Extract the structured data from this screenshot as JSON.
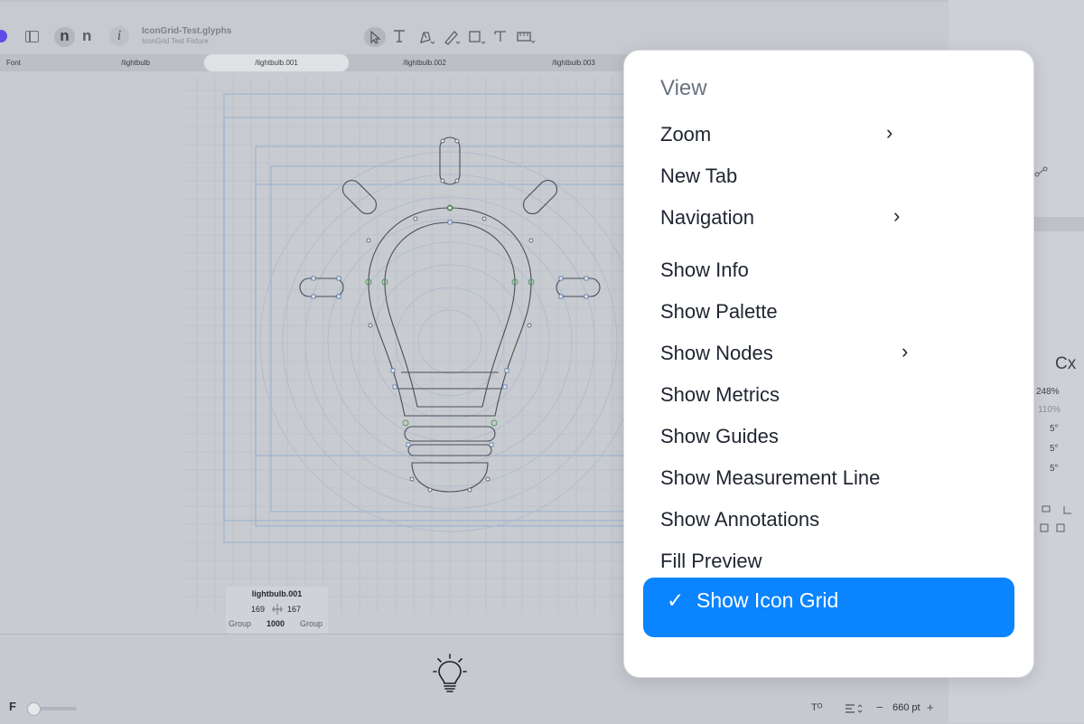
{
  "window": {
    "file_name": "IconGrid-Test.glyphs",
    "subtitle": "IconGrid Test Fixture"
  },
  "tabs": [
    {
      "label": "Font"
    },
    {
      "label": "/lightbulb"
    },
    {
      "label": "/lightbulb.001",
      "active": true
    },
    {
      "label": "/lightbulb.002"
    },
    {
      "label": "/lightbulb.003"
    }
  ],
  "glyph_info": {
    "name": "lightbulb.001",
    "lsb": "169",
    "rsb": "167",
    "left_group": "Group",
    "width": "1000",
    "right_group": "Group"
  },
  "bottom": {
    "font_letter": "F",
    "zoom_value": "660 pt",
    "zoom_minus": "−",
    "zoom_plus": "+",
    "text_tool": "Tᴼ",
    "align_icon": "align-left-icon"
  },
  "right_panel": {
    "zoom_pct": "248%",
    "zoom_pct2": "110%",
    "angle1": "5°",
    "angle2": "5°",
    "angle3": "5°",
    "label_cx": "Cx"
  },
  "menu": {
    "header": "View",
    "items": [
      {
        "label": "Zoom",
        "submenu": true
      },
      {
        "label": "New Tab",
        "submenu": false
      },
      {
        "label": "Navigation",
        "submenu": true
      },
      {
        "label": "Show Info",
        "submenu": false
      },
      {
        "label": "Show Palette",
        "submenu": false
      },
      {
        "label": "Show Nodes",
        "submenu": true
      },
      {
        "label": "Show Metrics",
        "submenu": false
      },
      {
        "label": "Show Guides",
        "submenu": false
      },
      {
        "label": "Show Measurement Line",
        "submenu": false
      },
      {
        "label": "Show Annotations",
        "submenu": false
      },
      {
        "label": "Fill Preview",
        "submenu": false
      }
    ],
    "selected_item": {
      "label": "Show Icon Grid",
      "checkmark": "✓",
      "checked": true
    },
    "chevron": "›"
  },
  "colors": {
    "accent": "#0a84ff",
    "canvas": "#c8cbd0",
    "outline": "#4a4e56",
    "grid_blue": "#8ea8cf"
  }
}
